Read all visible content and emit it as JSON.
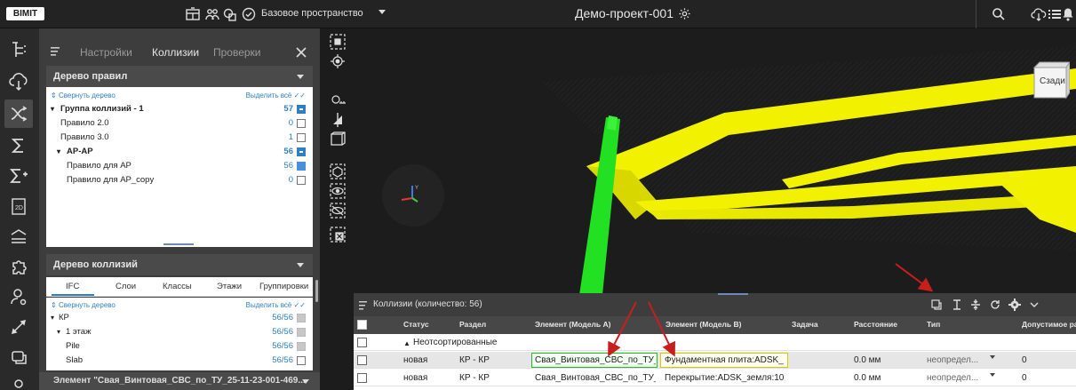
{
  "app": {
    "logo": "BIMIT",
    "space": "Базовое пространство",
    "project_title": "Демо-проект-001"
  },
  "panel": {
    "tabs": [
      "Настройки",
      "Коллизии",
      "Проверки"
    ],
    "active_tab": "Коллизии",
    "rules_tree": {
      "header": "Дерево правил",
      "collapse": "Свернуть дерево",
      "select_all": "Выделить всё",
      "items": [
        {
          "label": "Группа коллизий - 1",
          "count": "57",
          "state": "ind"
        },
        {
          "label": "Правило 2.0",
          "count": "0",
          "state": "empty"
        },
        {
          "label": "Правило 3.0",
          "count": "1",
          "state": "empty"
        },
        {
          "label": "АР-АР",
          "count": "56",
          "state": "ind"
        },
        {
          "label": "Правило для АР",
          "count": "56",
          "state": "chk"
        },
        {
          "label": "Правило для AP_copy",
          "count": "0",
          "state": "empty"
        }
      ]
    },
    "collision_tree": {
      "header": "Дерево коллизий",
      "subtabs": [
        "IFC",
        "Слои",
        "Классы",
        "Этажи",
        "Группировки"
      ],
      "collapse": "Свернуть дерево",
      "select_all": "Выделить всё",
      "items": [
        {
          "label": "КР",
          "count": "56/56",
          "state": "gray"
        },
        {
          "label": "1 этаж",
          "count": "56/56",
          "state": "gray"
        },
        {
          "label": "Pile",
          "count": "56/56",
          "state": "gray"
        },
        {
          "label": "Slab",
          "count": "56/56",
          "state": "empty"
        }
      ]
    },
    "element_bar": "Элемент \"Свая_Винтовая_СВС_по_ТУ_25-11-23-001-469..."
  },
  "viewport": {
    "cube_label": "Сзади"
  },
  "collisions": {
    "title": "Коллизии (количество: 56)",
    "columns": [
      "Статус",
      "Раздел",
      "Элемент (Модель А)",
      "Элемент (Модель В)",
      "Задача",
      "Расстояние",
      "Тип",
      "Допустимое ра"
    ],
    "group_label": "Неотсортированные",
    "rows": [
      {
        "status": "новая",
        "section": "КР - КР",
        "elem_a": "Свая_Винтовая_СВС_по_ТУ_",
        "elem_b": "Фундаментная плита:ADSK_",
        "task": "",
        "distance": "0.0 мм",
        "type": "неопредел...",
        "allowed": "0"
      },
      {
        "status": "новая",
        "section": "КР - КР",
        "elem_a": "Свая_Винтовая_СВС_по_ТУ_",
        "elem_b": "Перекрытие:ADSK_земля:10",
        "task": "",
        "distance": "0.0 мм",
        "type": "неопредел...",
        "allowed": "0"
      }
    ]
  },
  "colors": {
    "accent": "#2f7fc1",
    "beam": "#f2f200",
    "pile": "#22e022",
    "arrow": "#c81e1e"
  }
}
